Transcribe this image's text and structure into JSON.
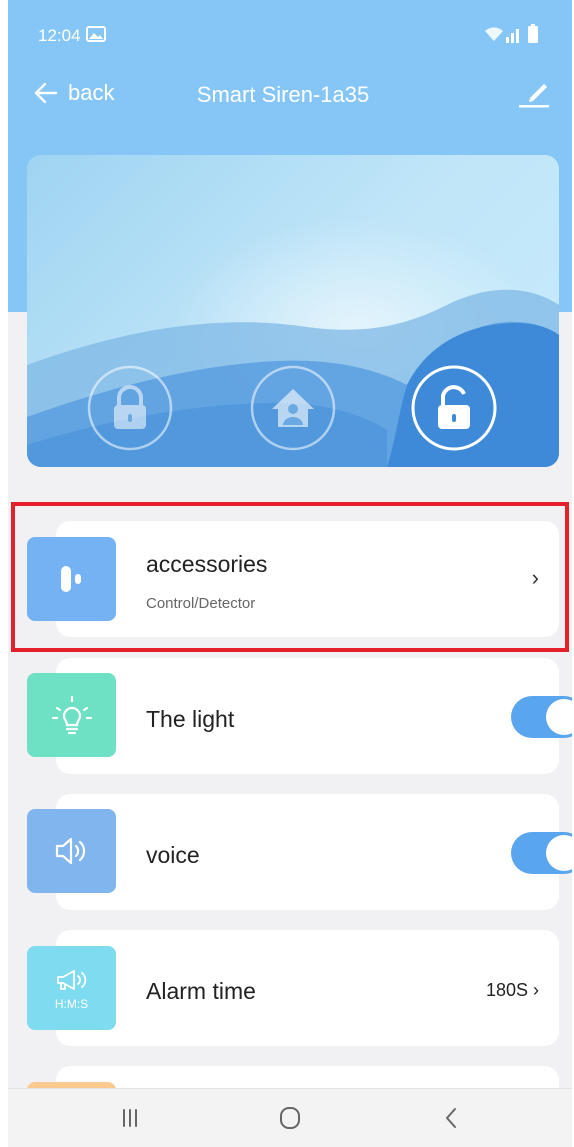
{
  "status_bar": {
    "time": "12:04"
  },
  "header": {
    "back_label": "back",
    "title": "Smart Siren-1a35"
  },
  "hero": {
    "modes": [
      "arm",
      "home",
      "disarm"
    ],
    "active_mode": "disarm"
  },
  "list": {
    "accessories": {
      "label": "accessories",
      "sublabel": "Control/Detector"
    },
    "light": {
      "label": "The light",
      "enabled": true
    },
    "voice": {
      "label": "voice",
      "enabled": true
    },
    "alarm_time": {
      "label": "Alarm time",
      "value": "180S",
      "tile_text": "H:M:S"
    }
  },
  "colors": {
    "header_bg": "#86c6f6",
    "accessories_tile": "#74b2f4",
    "light_tile": "#6ee0c3",
    "voice_tile": "#80b5ee",
    "alarm_tile": "#7edbf0",
    "toggle_on": "#5aa6ee",
    "highlight": "#e4202a"
  },
  "icons": [
    "gallery-icon",
    "wifi-icon",
    "signal-icon",
    "battery-icon",
    "back-arrow-icon",
    "edit-icon",
    "lock-icon",
    "home-person-icon",
    "unlock-icon",
    "door-sensor-icon",
    "bulb-icon",
    "speaker-icon",
    "megaphone-icon",
    "chevron-right-icon"
  ]
}
